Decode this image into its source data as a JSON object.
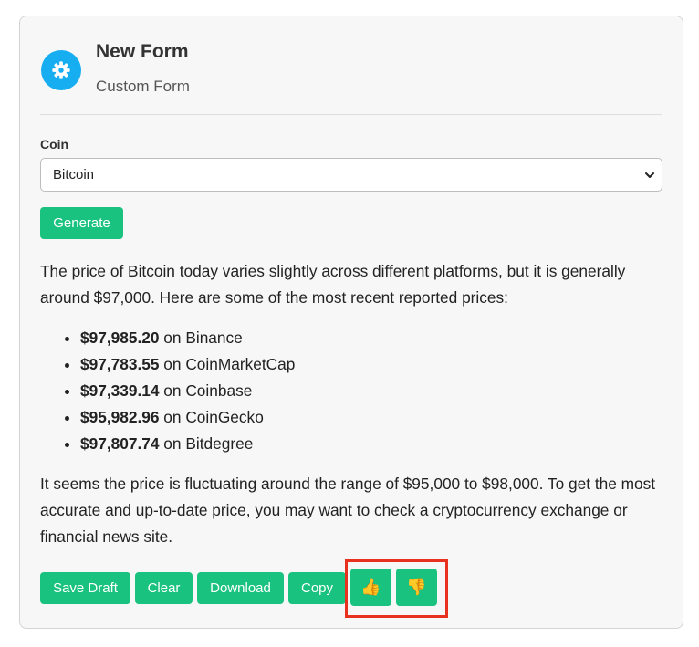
{
  "header": {
    "title": "New Form",
    "subtitle": "Custom Form",
    "icon": "gear-icon",
    "icon_color": "#16aef0"
  },
  "form": {
    "coin_label": "Coin",
    "coin_value": "Bitcoin",
    "generate_label": "Generate"
  },
  "result": {
    "intro": "The price of Bitcoin today varies slightly across different platforms, but it is generally around $97,000. Here are some of the most recent reported prices:",
    "prices": [
      {
        "price": "$97,985.20",
        "source": " on Binance"
      },
      {
        "price": "$97,783.55",
        "source": " on CoinMarketCap"
      },
      {
        "price": "$97,339.14",
        "source": " on Coinbase"
      },
      {
        "price": "$95,982.96",
        "source": " on CoinGecko"
      },
      {
        "price": "$97,807.74",
        "source": " on Bitdegree"
      }
    ],
    "conclusion": "It seems the price is fluctuating around the range of $95,000 to $98,000. To get the most accurate and up-to-date price, you may want to check a cryptocurrency exchange or financial news site."
  },
  "actions": {
    "save_draft": "Save Draft",
    "clear": "Clear",
    "download": "Download",
    "copy": "Copy",
    "thumbs_up": "👍",
    "thumbs_down": "👎"
  },
  "colors": {
    "accent": "#19c27e",
    "highlight": "#e8321f"
  }
}
